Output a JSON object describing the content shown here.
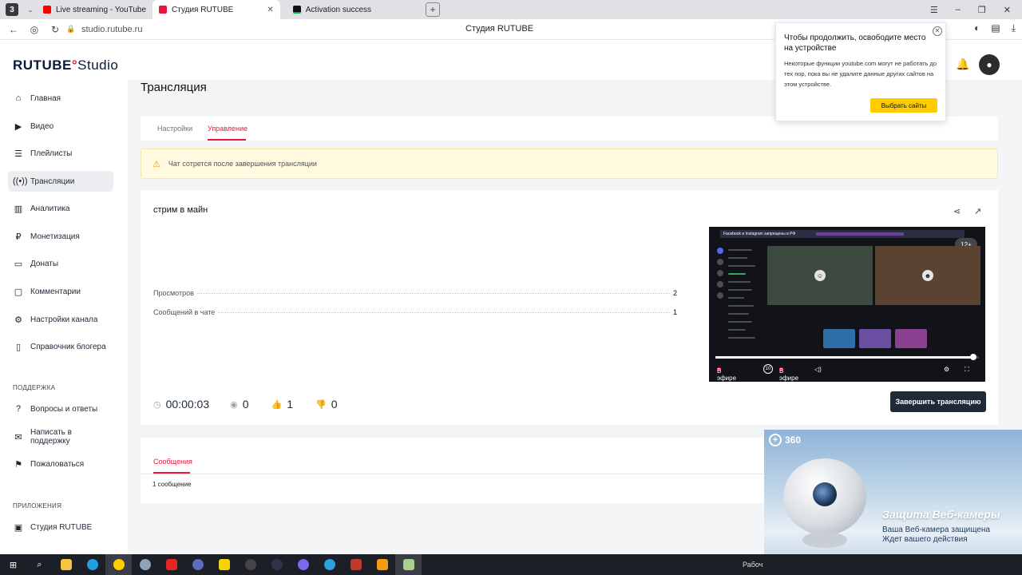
{
  "browser": {
    "tabs": [
      {
        "label": "Live streaming - YouTube",
        "color": "#ff0000"
      },
      {
        "label": "Студия RUTUBE",
        "color": "#ed143b"
      },
      {
        "label": "Activation success",
        "color": "#00b050"
      }
    ],
    "url": "studio.rutube.ru",
    "page_title": "Студия RUTUBE"
  },
  "header": {
    "logo_main": "RUTUBE",
    "logo_studio": "Studio"
  },
  "sidebar": {
    "items": [
      {
        "label": "Главная",
        "icon": "home-icon"
      },
      {
        "label": "Видео",
        "icon": "video-icon"
      },
      {
        "label": "Плейлисты",
        "icon": "playlist-icon"
      },
      {
        "label": "Трансляции",
        "icon": "broadcast-icon",
        "active": true
      },
      {
        "label": "Аналитика",
        "icon": "chart-icon"
      },
      {
        "label": "Монетизация",
        "icon": "money-icon"
      },
      {
        "label": "Донаты",
        "icon": "donate-icon"
      },
      {
        "label": "Комментарии",
        "icon": "comment-icon"
      },
      {
        "label": "Настройки канала",
        "icon": "gear-icon"
      },
      {
        "label": "Справочник блогера",
        "icon": "book-icon"
      }
    ],
    "support_title": "ПОДДЕРЖКА",
    "support_items": [
      {
        "label": "Вопросы и ответы",
        "icon": "question-icon"
      },
      {
        "label": "Написать в поддержку",
        "icon": "mail-icon"
      },
      {
        "label": "Пожаловаться",
        "icon": "flag-icon"
      }
    ],
    "apps_title": "ПРИЛОЖЕНИЯ",
    "apps_items": [
      {
        "label": "Студия RUTUBE",
        "icon": "app-icon"
      }
    ]
  },
  "main": {
    "section_title": "Трансляция",
    "tabs": [
      {
        "label": "Настройки"
      },
      {
        "label": "Управление",
        "active": true
      }
    ],
    "warning": "Чат сотрется после завершения трансляции",
    "stream": {
      "name": "стрим в майн",
      "stats": [
        {
          "label": "Просмотров",
          "value": "2"
        },
        {
          "label": "Сообщений в чате",
          "value": "1"
        }
      ],
      "duration": "00:00:03",
      "viewers": "0",
      "likes": "1",
      "dislikes": "0",
      "end_button": "Завершить трансляцию"
    },
    "player": {
      "age_rating": "12+",
      "overlay_title": "Facebook и Instagram запрещены в РФ",
      "live_label_left": "В эфире",
      "live_label": "В эфире",
      "skip_label": "10",
      "progress": 0.98
    },
    "messages": {
      "tab": "Сообщения",
      "count": "1 сообщение"
    }
  },
  "notification": {
    "title": "Чтобы продолжить, освободите место на устройстве",
    "body": "Некоторые функции youtube.com могут не работать до тех пор, пока вы не удалите данные других сайтов на этом устройстве.",
    "button": "Выбрать сайты"
  },
  "ad": {
    "brand": "360",
    "headline": "Защита Веб-камеры",
    "line1": "Ваша Веб-камера защищена",
    "line2": "Ждет вашего действия"
  },
  "taskbar": {
    "right_text": "Рабоч"
  }
}
